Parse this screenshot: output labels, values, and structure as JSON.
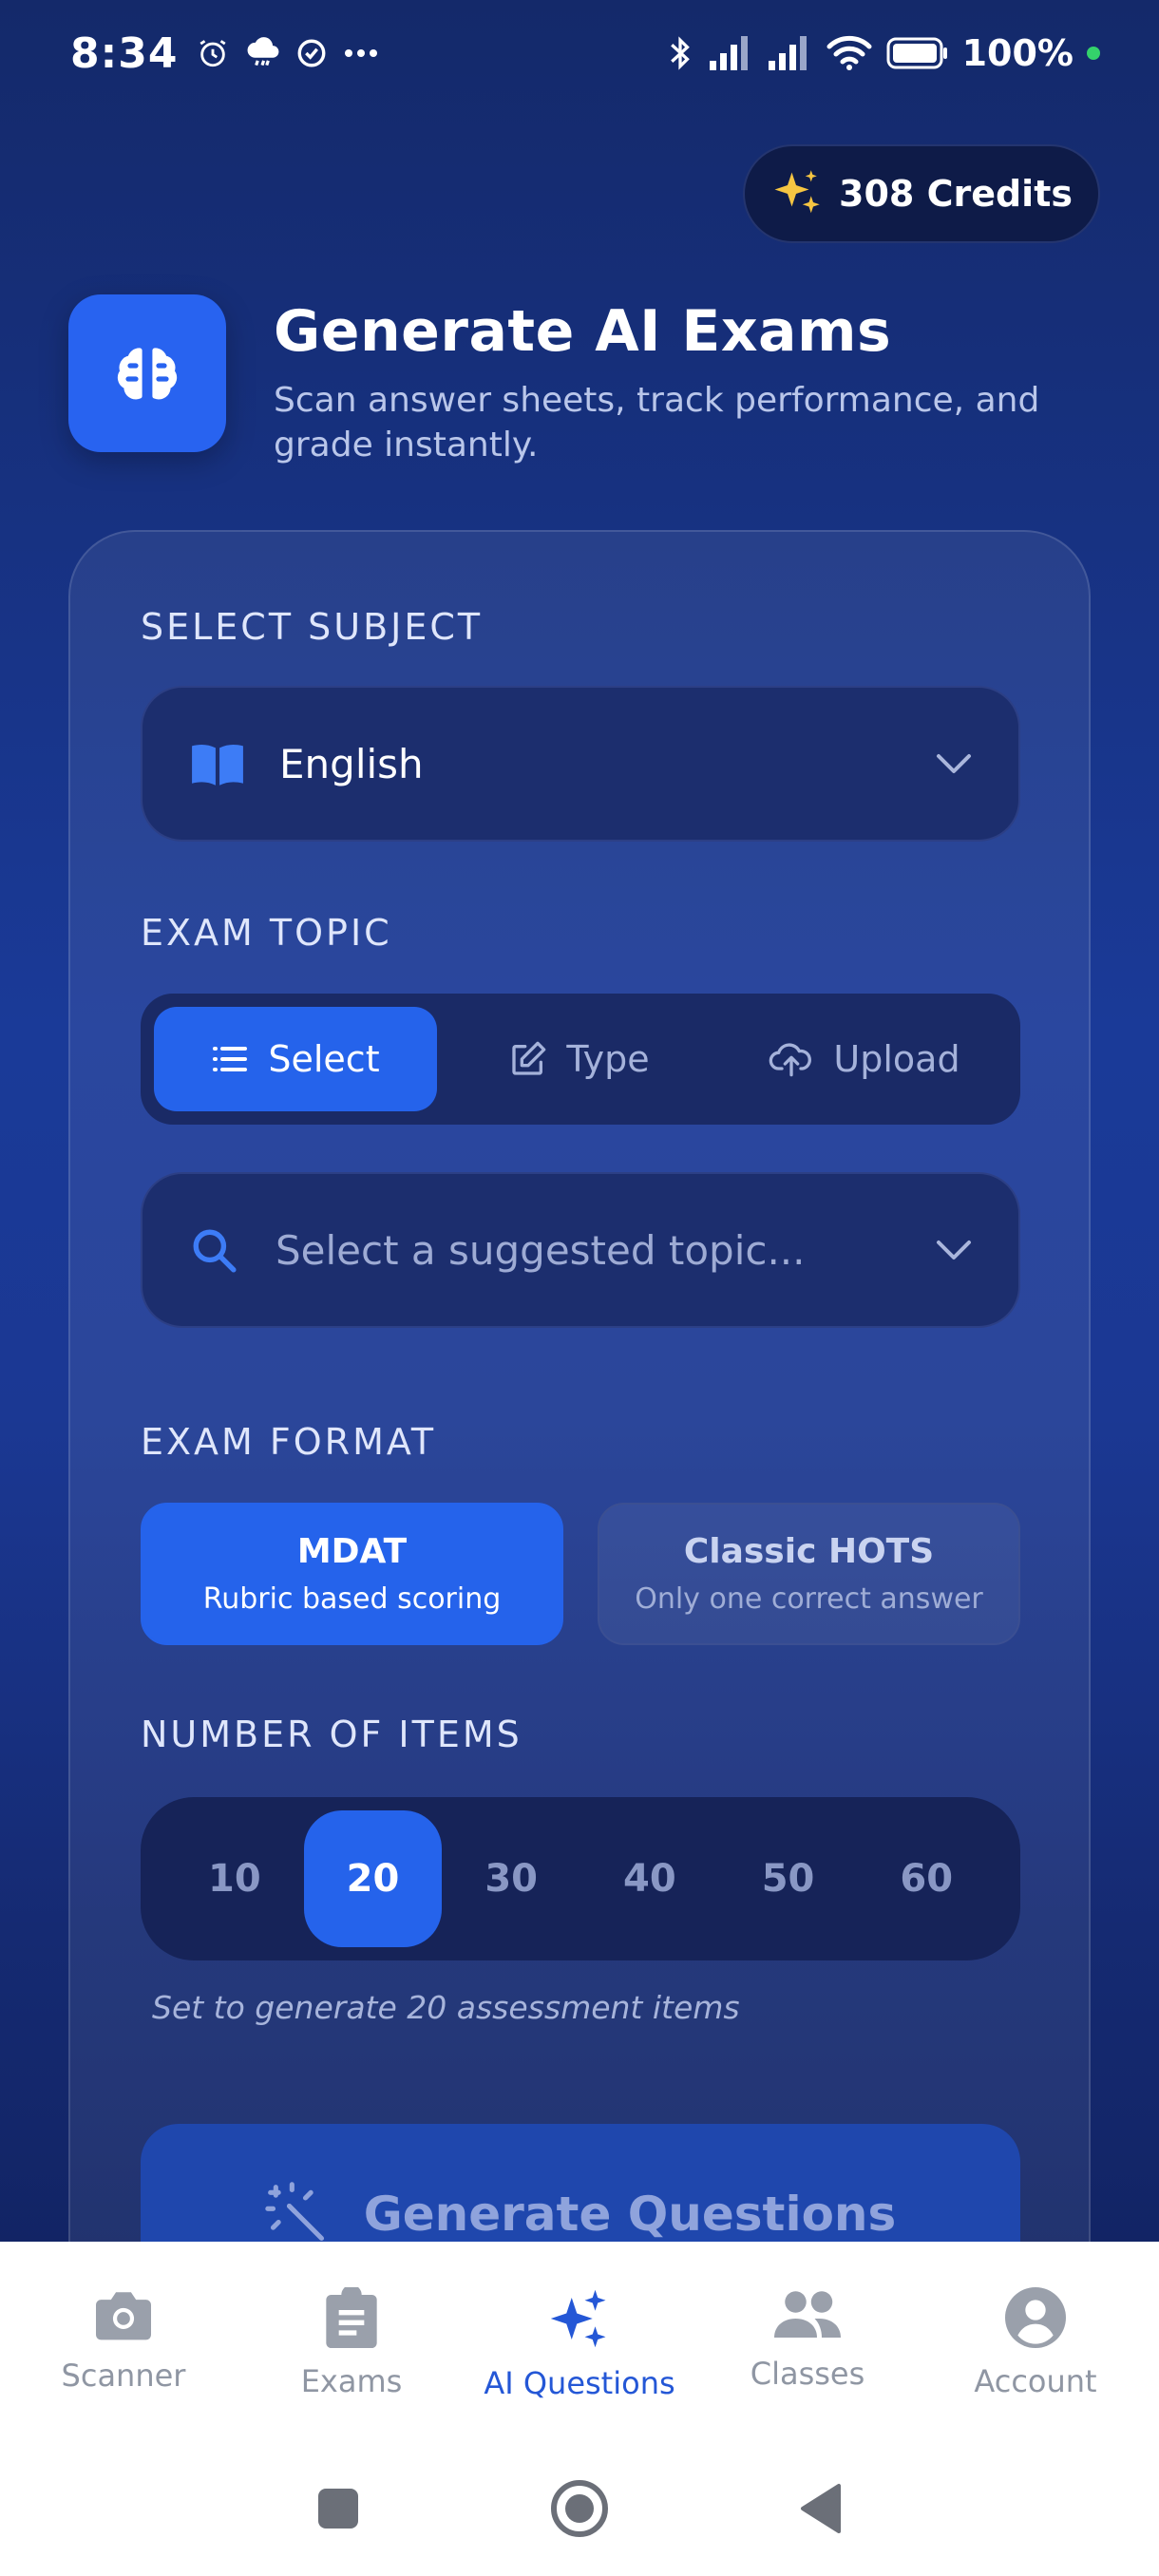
{
  "status_bar": {
    "time": "8:34",
    "battery": "100%"
  },
  "credits": {
    "label": "308 Credits"
  },
  "header": {
    "title": "Generate AI Exams",
    "subtitle": "Scan answer sheets, track performance, and grade instantly."
  },
  "subject": {
    "section_label": "SELECT SUBJECT",
    "value": "English"
  },
  "topic": {
    "section_label": "EXAM TOPIC",
    "modes": [
      {
        "label": "Select",
        "active": true
      },
      {
        "label": "Type",
        "active": false
      },
      {
        "label": "Upload",
        "active": false
      }
    ],
    "placeholder": "Select a suggested topic..."
  },
  "format": {
    "section_label": "EXAM FORMAT",
    "options": [
      {
        "title": "MDAT",
        "desc": "Rubric based scoring",
        "active": true
      },
      {
        "title": "Classic HOTS",
        "desc": "Only one correct answer",
        "active": false
      }
    ]
  },
  "items": {
    "section_label": "NUMBER OF ITEMS",
    "options": [
      "10",
      "20",
      "30",
      "40",
      "50",
      "60"
    ],
    "selected": "20",
    "hint": "Set to generate 20 assessment items"
  },
  "generate": {
    "label": "Generate Questions"
  },
  "nav": {
    "items": [
      {
        "label": "Scanner",
        "icon": "camera-icon",
        "active": false
      },
      {
        "label": "Exams",
        "icon": "clipboard-icon",
        "active": false
      },
      {
        "label": "AI Questions",
        "icon": "sparkles-icon",
        "active": true
      },
      {
        "label": "Classes",
        "icon": "people-icon",
        "active": false
      },
      {
        "label": "Account",
        "icon": "account-icon",
        "active": false
      }
    ]
  },
  "colors": {
    "accent": "#2563eb",
    "active_nav": "#2457d6",
    "credits_star": "#f5c542"
  }
}
